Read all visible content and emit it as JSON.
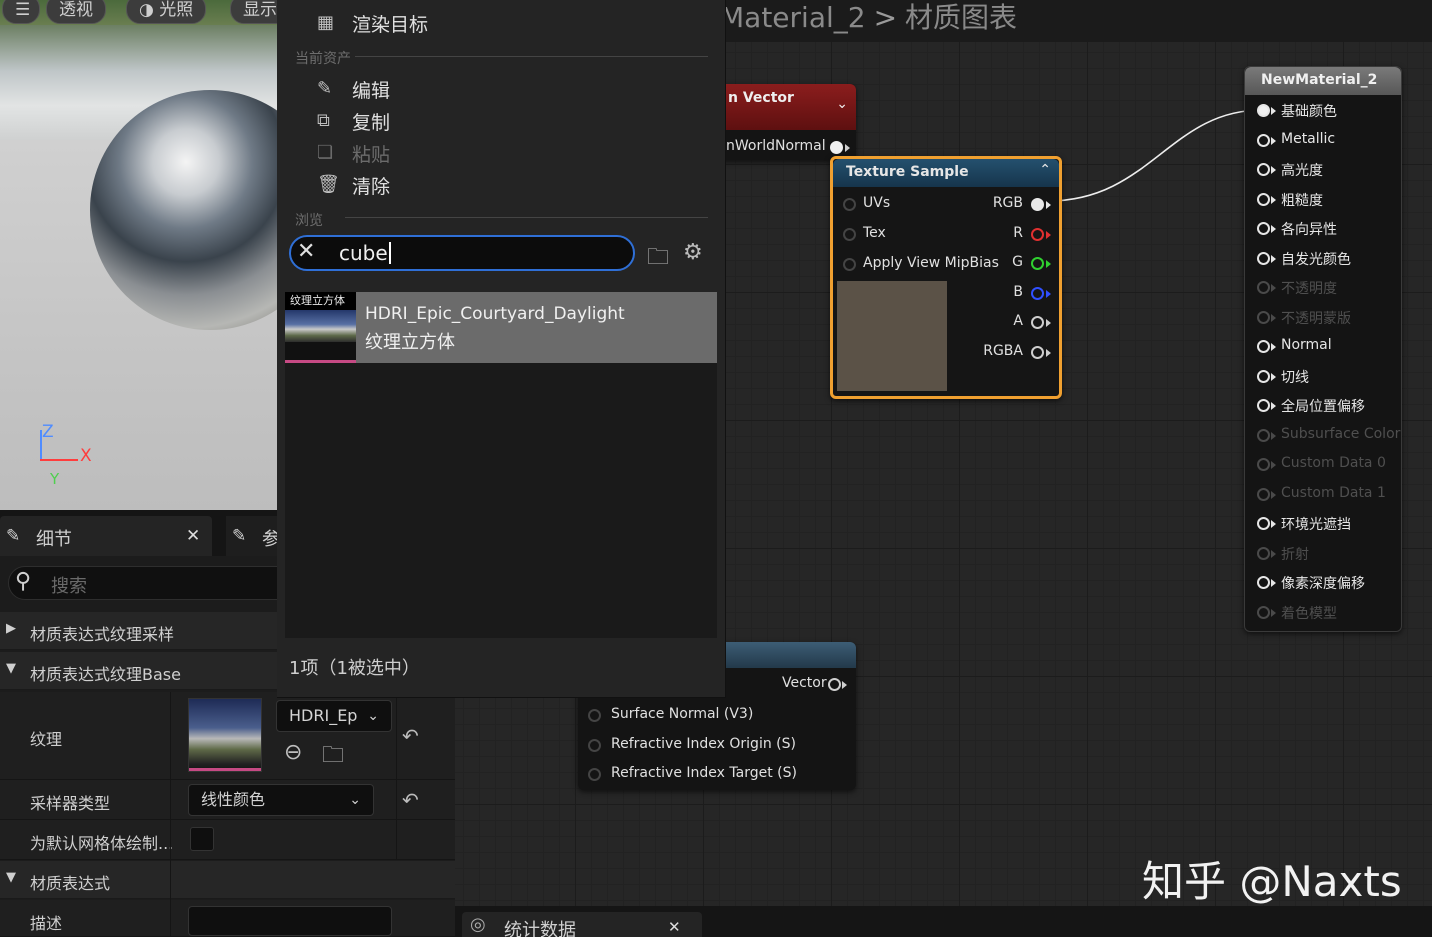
{
  "graph": {
    "breadcrumb_left": "Material_2",
    "breadcrumb_right": "材质图表"
  },
  "viewport": {
    "buttons": [
      {
        "label": "☰"
      },
      {
        "label": "透视"
      },
      {
        "label": "光照"
      },
      {
        "label": "显示"
      }
    ],
    "axes": {
      "z": "Z",
      "x": "X",
      "y": "Y"
    }
  },
  "details": {
    "tab_label": "细节",
    "tab2_label": "参",
    "search_placeholder": "搜索",
    "sections": [
      {
        "label": "材质表达式纹理采样"
      },
      {
        "label": "材质表达式纹理Base"
      },
      {
        "label": "材质表达式"
      }
    ],
    "props": {
      "texture_label": "纹理",
      "texture_value": "HDRI_Ep",
      "sampler_label": "采样器类型",
      "sampler_value": "线性颜色",
      "default_mesh_label": "为默认网格体绘制...",
      "desc_label": "描述"
    }
  },
  "stats": {
    "label": "统计数据"
  },
  "menu": {
    "items_top": [
      {
        "label": "渲染目标"
      }
    ],
    "header_current": "当前资产",
    "items_current": [
      {
        "label": "编辑",
        "enabled": true
      },
      {
        "label": "复制",
        "enabled": true
      },
      {
        "label": "粘贴",
        "enabled": false
      },
      {
        "label": "清除",
        "enabled": true
      }
    ],
    "header_browse": "浏览",
    "search_value": "cube",
    "result": {
      "tag": "纹理立方体",
      "name": "HDRI_Epic_Courtyard_Daylight",
      "type": "纹理立方体"
    },
    "footer": "1项（1被选中）"
  },
  "nodes": {
    "vector": {
      "title": "n Vector",
      "out": "nWorldNormal"
    },
    "texture_sample": {
      "title": "Texture Sample",
      "inputs": [
        "UVs",
        "Tex",
        "Apply View MipBias"
      ],
      "outputs": [
        "RGB",
        "R",
        "G",
        "B",
        "A",
        "RGBA"
      ],
      "output_colors": [
        "#e8e8e8",
        "#e03030",
        "#30d030",
        "#3050ff",
        "#cfcfcf",
        "#cfcfcf"
      ]
    },
    "material": {
      "title": "NewMaterial_2",
      "pins": [
        {
          "label": "基础颜色",
          "enabled": true
        },
        {
          "label": "Metallic",
          "enabled": true
        },
        {
          "label": "高光度",
          "enabled": true
        },
        {
          "label": "粗糙度",
          "enabled": true
        },
        {
          "label": "各向异性",
          "enabled": true
        },
        {
          "label": "自发光颜色",
          "enabled": true
        },
        {
          "label": "不透明度",
          "enabled": false
        },
        {
          "label": "不透明蒙版",
          "enabled": false
        },
        {
          "label": "Normal",
          "enabled": true
        },
        {
          "label": "切线",
          "enabled": true
        },
        {
          "label": "全局位置偏移",
          "enabled": true
        },
        {
          "label": "Subsurface Color",
          "enabled": false
        },
        {
          "label": "Custom Data 0",
          "enabled": false
        },
        {
          "label": "Custom Data 1",
          "enabled": false
        },
        {
          "label": "环境光遮挡",
          "enabled": true
        },
        {
          "label": "折射",
          "enabled": false
        },
        {
          "label": "像素深度偏移",
          "enabled": true
        },
        {
          "label": "着色模型",
          "enabled": false
        }
      ]
    },
    "vector2": {
      "out": "Vector",
      "inputs": [
        "Surface Normal (V3)",
        "Refractive Index Origin (S)",
        "Refractive Index Target (S)"
      ]
    }
  },
  "watermark": "知乎 @Naxts"
}
